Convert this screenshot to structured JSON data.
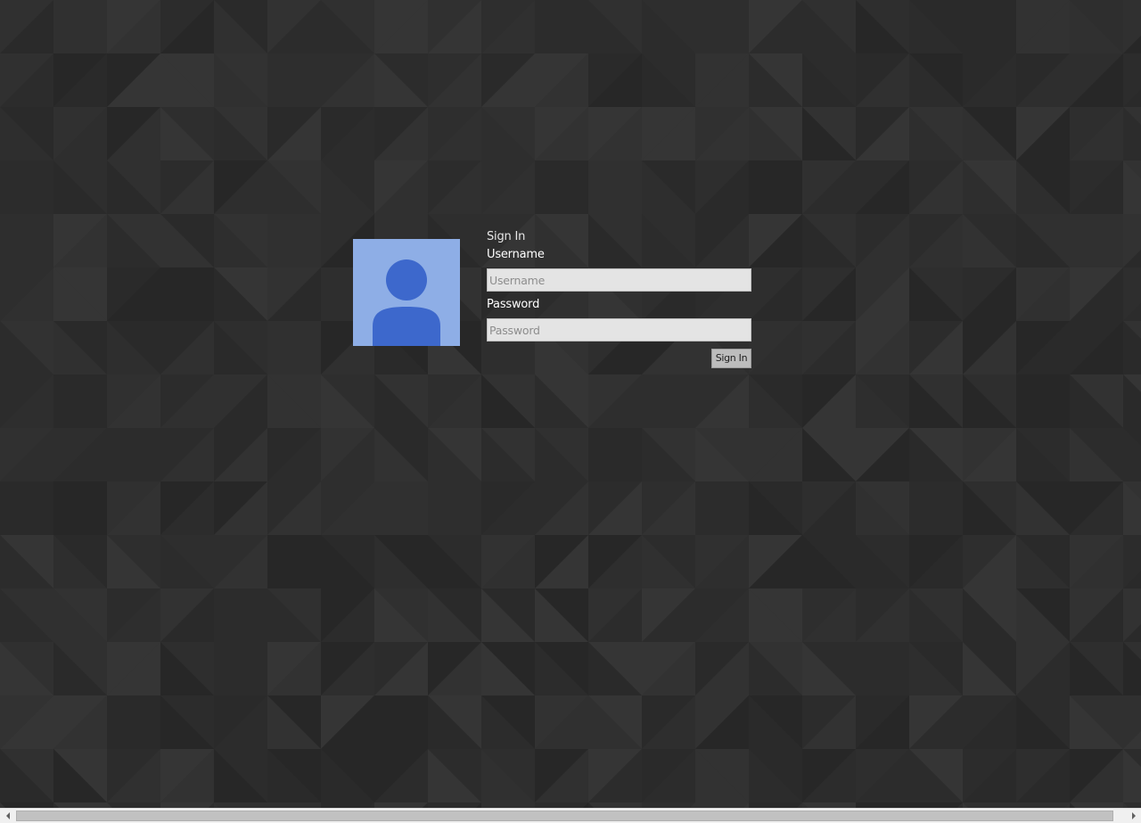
{
  "colors": {
    "background": "#2d2d2d",
    "avatar_bg": "#8eaee6",
    "avatar_figure": "#3d68cc",
    "input_bg": "#e4e4e4",
    "button_bg": "#bdbdbd",
    "label_text": "#ffffff"
  },
  "login": {
    "title": "Sign In",
    "username_label": "Username",
    "username_value": "",
    "username_placeholder": "Username",
    "password_label": "Password",
    "password_value": "",
    "password_placeholder": "Password",
    "submit_label": "Sign In"
  },
  "avatar": {
    "icon": "user-icon"
  },
  "scrollbar": {
    "orientation": "horizontal",
    "left_icon": "arrow-left-icon",
    "right_icon": "arrow-right-icon"
  }
}
